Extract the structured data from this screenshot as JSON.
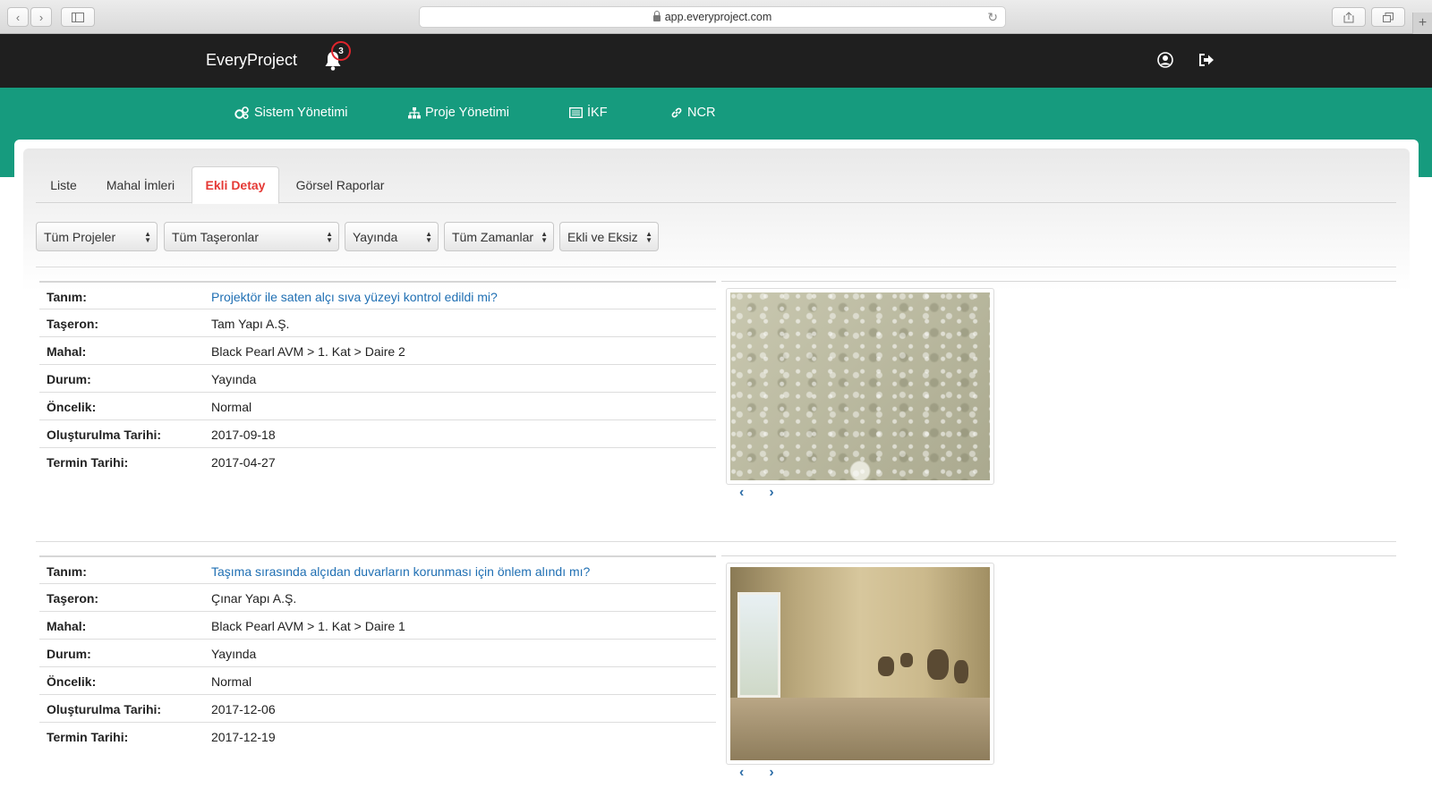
{
  "browser": {
    "url": "app.everyproject.com"
  },
  "header": {
    "brand": "EveryProject",
    "notification_count": "3"
  },
  "nav": [
    {
      "label": "Sistem Yönetimi",
      "icon": "cogs-icon"
    },
    {
      "label": "Proje Yönetimi",
      "icon": "sitemap-icon"
    },
    {
      "label": "İKF",
      "icon": "list-alt-icon"
    },
    {
      "label": "NCR",
      "icon": "link-icon"
    }
  ],
  "tabs": [
    {
      "label": "Liste",
      "active": false
    },
    {
      "label": "Mahal İmleri",
      "active": false
    },
    {
      "label": "Ekli Detay",
      "active": true
    },
    {
      "label": "Görsel Raporlar",
      "active": false
    }
  ],
  "filters": [
    {
      "value": "Tüm Projeler"
    },
    {
      "value": "Tüm Taşeronlar"
    },
    {
      "value": "Yayında"
    },
    {
      "value": "Tüm Zamanlar"
    },
    {
      "value": "Ekli ve Eksiz"
    }
  ],
  "labels": {
    "tanim": "Tanım:",
    "taseron": "Taşeron:",
    "mahal": "Mahal:",
    "durum": "Durum:",
    "oncelik": "Öncelik:",
    "olusturulma": "Oluşturulma Tarihi:",
    "termin": "Termin Tarihi:"
  },
  "records": [
    {
      "tanim": "Projektör ile saten alçı sıva yüzeyi kontrol edildi mi?",
      "taseron": "Tam Yapı A.Ş.",
      "mahal": "Black Pearl AVM > 1. Kat > Daire 2",
      "durum": "Yayında",
      "oncelik": "Normal",
      "olusturulma": "2017-09-18",
      "termin": "2017-04-27"
    },
    {
      "tanim": "Taşıma sırasında alçıdan duvarların korunması için önlem alındı mı?",
      "taseron": "Çınar Yapı A.Ş.",
      "mahal": "Black Pearl AVM > 1. Kat > Daire 1",
      "durum": "Yayında",
      "oncelik": "Normal",
      "olusturulma": "2017-12-06",
      "termin": "2017-12-19"
    }
  ],
  "colors": {
    "header_bg": "#1f1f1f",
    "nav_bg": "#169b7e",
    "active_tab": "#e53935",
    "link": "#1f6fb3"
  }
}
